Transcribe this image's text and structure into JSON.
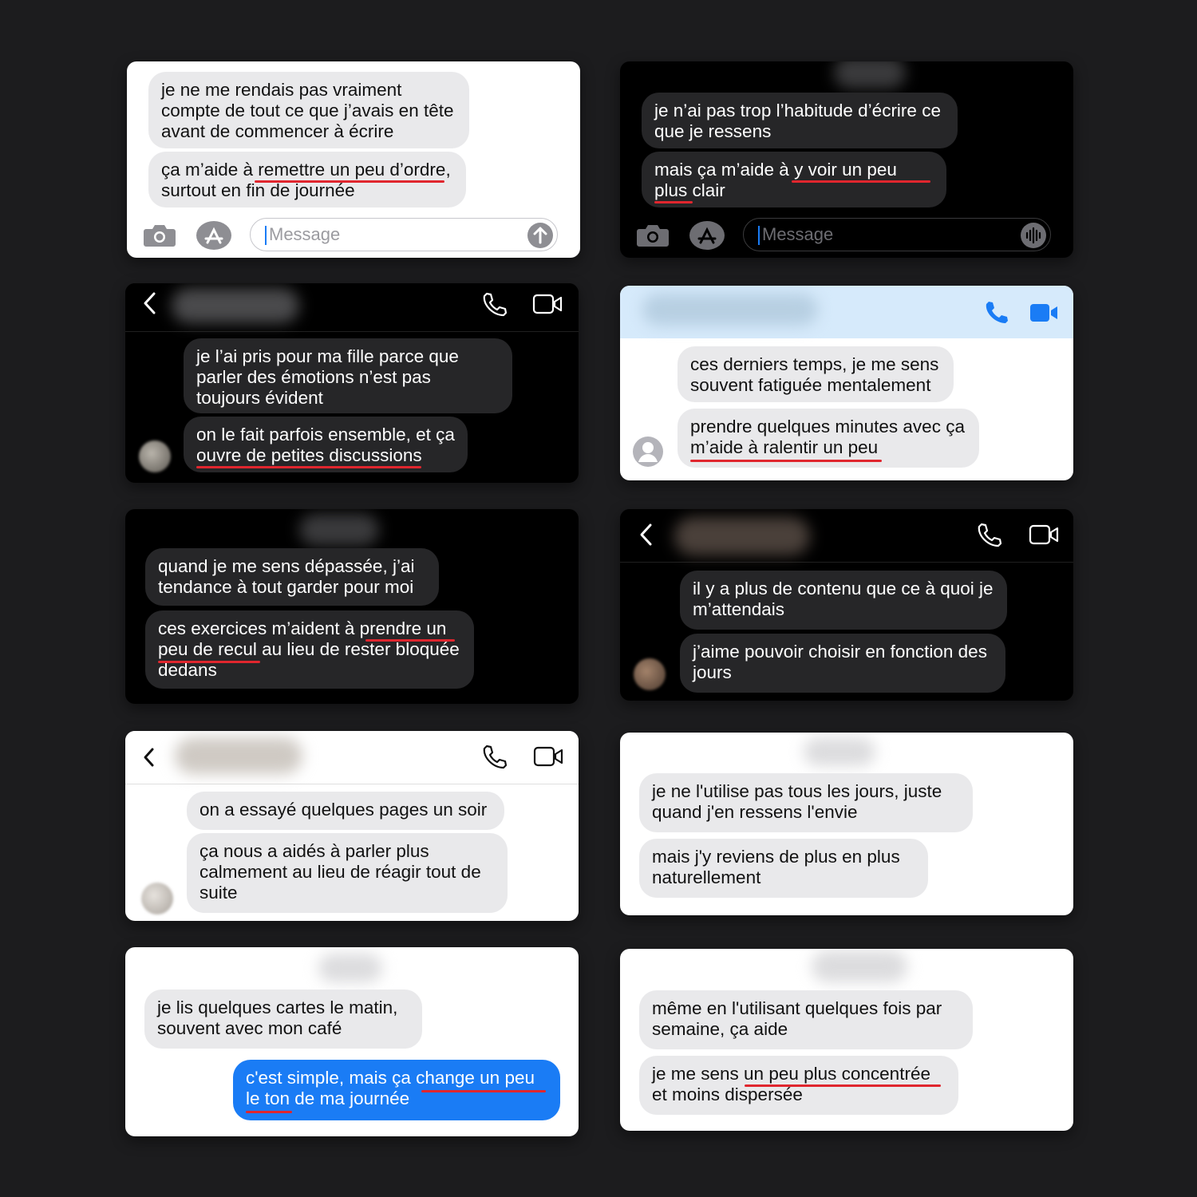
{
  "cards": [
    {
      "bubbles": [
        "je ne me rendais pas vraiment compte de tout ce que j’avais en tête avant de commencer à écrire",
        "ça m’aide à remettre un peu d’ordre, surtout en fin de journée"
      ],
      "input_placeholder": "Message",
      "icons": [
        "camera-icon",
        "app-store-icon",
        "send-arrow-icon"
      ]
    },
    {
      "bubbles": [
        "je n’ai pas trop l’habitude d’écrire ce que je ressens",
        "mais ça m’aide à y voir un peu plus clair"
      ],
      "input_placeholder": "Message",
      "icons": [
        "camera-icon",
        "app-store-icon",
        "audio-waveform-icon"
      ]
    },
    {
      "bubbles": [
        "je l’ai pris pour ma fille parce que parler des émotions n’est pas toujours évident",
        "on le fait parfois ensemble, et ça ouvre de petites discussions"
      ],
      "icons": [
        "back-chevron-icon",
        "phone-icon",
        "video-icon"
      ]
    },
    {
      "bubbles": [
        "ces derniers temps, je me sens souvent fatiguée mentalement",
        "prendre quelques minutes avec ça m’aide à ralentir un peu"
      ],
      "icons": [
        "phone-icon",
        "video-icon",
        "person-icon"
      ]
    },
    {
      "bubbles": [
        "quand je me sens dépassée, j’ai tendance à tout garder pour moi",
        "ces exercices m’aident à prendre un peu de recul au lieu de rester bloquée dedans"
      ]
    },
    {
      "bubbles": [
        "il y a plus de contenu que ce à quoi je m’attendais",
        "j’aime pouvoir choisir en fonction des jours"
      ],
      "icons": [
        "back-chevron-icon",
        "phone-icon",
        "video-icon"
      ]
    },
    {
      "bubbles": [
        "on a essayé quelques pages un soir",
        "ça nous a aidés à parler plus calmement au lieu de réagir tout de suite"
      ],
      "icons": [
        "back-chevron-icon",
        "phone-icon",
        "video-icon"
      ]
    },
    {
      "bubbles": [
        "je ne l'utilise pas tous les jours, juste quand j'en ressens l'envie",
        "mais j'y reviens de plus en plus naturellement"
      ]
    },
    {
      "bubbles": [
        "je lis quelques cartes le matin, souvent avec mon café",
        "c'est simple, mais ça change un peu le ton de ma journée"
      ]
    },
    {
      "bubbles": [
        "même en l'utilisant quelques fois par semaine, ça aide",
        "je me sens un peu plus concentrée et moins dispersée"
      ]
    }
  ],
  "colors": {
    "background": "#1c1c1e",
    "light_bubble": "#e9e9eb",
    "dark_bubble": "#262628",
    "imessage_blue": "#1a7cf5",
    "accent_blue": "#1a7cf5",
    "underline_red": "#e0262e"
  }
}
